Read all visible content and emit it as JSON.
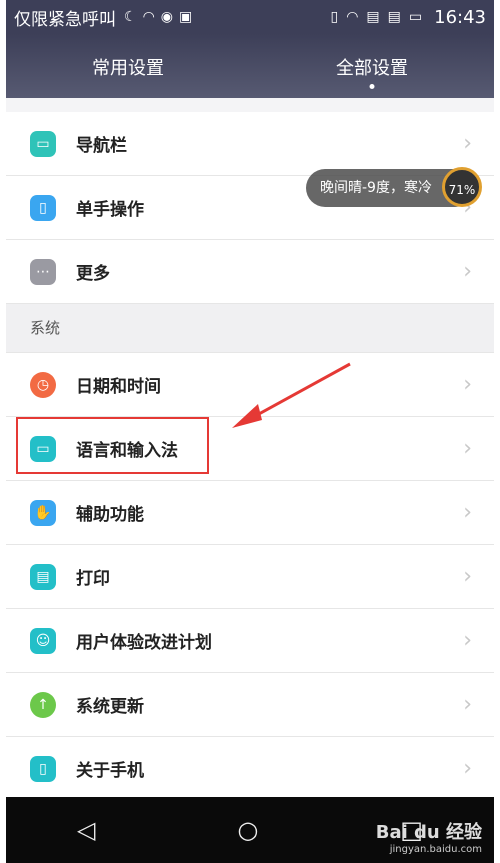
{
  "status": {
    "carrier": "仅限紧急呼叫",
    "time": "16:43"
  },
  "tabs": [
    {
      "label": "常用设置"
    },
    {
      "label": "全部设置"
    }
  ],
  "items_top": [
    {
      "label": "导航栏",
      "icon": "navbar-icon",
      "color": "#2fc3b8"
    },
    {
      "label": "单手操作",
      "icon": "one-hand-icon",
      "color": "#3aa6f0"
    },
    {
      "label": "更多",
      "icon": "more-icon",
      "color": "#9a9aa2"
    }
  ],
  "section": {
    "label": "系统"
  },
  "items_sys": [
    {
      "label": "日期和时间",
      "icon": "clock-icon",
      "color": "#f26a43"
    },
    {
      "label": "语言和输入法",
      "icon": "keyboard-icon",
      "color": "#23bfc8"
    },
    {
      "label": "辅助功能",
      "icon": "hand-icon",
      "color": "#3aa6f0"
    },
    {
      "label": "打印",
      "icon": "printer-icon",
      "color": "#23bfc8"
    },
    {
      "label": "用户体验改进计划",
      "icon": "user-icon",
      "color": "#23bfc8"
    },
    {
      "label": "系统更新",
      "icon": "update-icon",
      "color": "#6cc84a"
    },
    {
      "label": "关于手机",
      "icon": "phone-icon",
      "color": "#23bfc8"
    }
  ],
  "weather": {
    "text": "晚间晴-9度，寒冷",
    "percent": "71%"
  },
  "watermark": {
    "brand": "Bai du 经验",
    "url": "jingyan.baidu.com"
  }
}
